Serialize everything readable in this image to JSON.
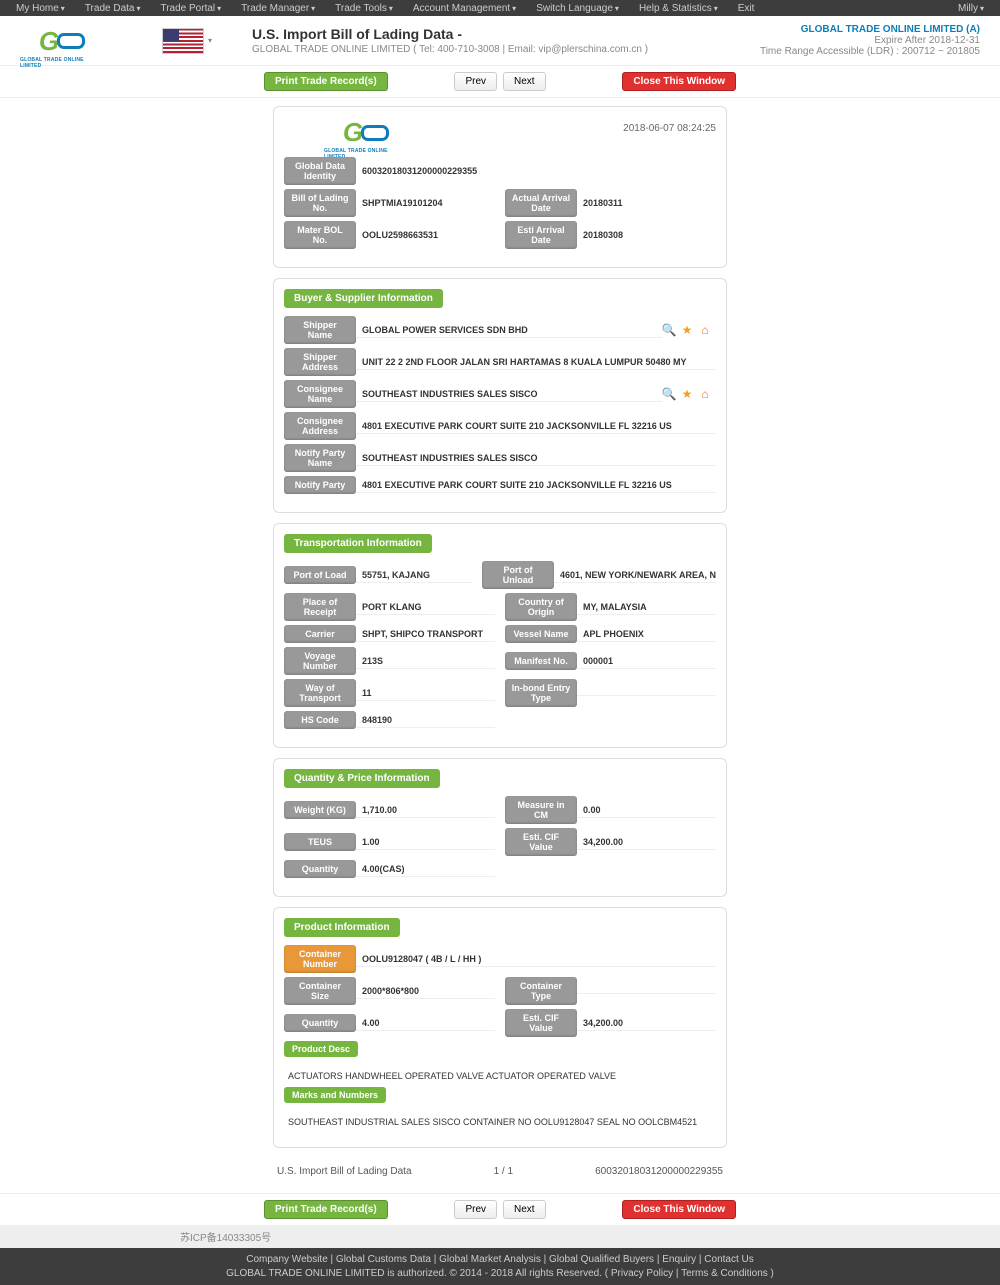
{
  "nav": {
    "items": [
      "My Home",
      "Trade Data",
      "Trade Portal",
      "Trade Manager",
      "Trade Tools",
      "Account Management",
      "Switch Language",
      "Help & Statistics",
      "Exit"
    ],
    "user": "Milly"
  },
  "header": {
    "title": "U.S. Import Bill of Lading Data  -",
    "sub": "GLOBAL TRADE ONLINE LIMITED ( Tel: 400-710-3008 | Email: vip@plerschina.com.cn )",
    "company": "GLOBAL TRADE ONLINE LIMITED (A)",
    "expire": "Expire After 2018-12-31",
    "range": "Time Range Accessible (LDR) : 200712 ~ 201805"
  },
  "buttons": {
    "print": "Print Trade Record(s)",
    "prev": "Prev",
    "next": "Next",
    "close": "Close This Window"
  },
  "record": {
    "timestamp": "2018-06-07 08:24:25",
    "identity_label": "Global Data Identity",
    "identity": "60032018031200000229355",
    "bol_label": "Bill of Lading No.",
    "bol": "SHPTMIA19101204",
    "mbol_label": "Mater BOL No.",
    "mbol": "OOLU2598663531",
    "aad_label": "Actual Arrival Date",
    "aad": "20180311",
    "ead_label": "Esti Arrival Date",
    "ead": "20180308"
  },
  "buyer": {
    "title": "Buyer & Supplier Information",
    "shipper_name_l": "Shipper Name",
    "shipper_name": "GLOBAL POWER SERVICES SDN BHD",
    "shipper_addr_l": "Shipper Address",
    "shipper_addr": "UNIT 22 2 2ND FLOOR JALAN SRI HARTAMAS 8 KUALA LUMPUR 50480 MY",
    "consignee_name_l": "Consignee Name",
    "consignee_name": "SOUTHEAST INDUSTRIES SALES SISCO",
    "consignee_addr_l": "Consignee Address",
    "consignee_addr": "4801 EXECUTIVE PARK COURT SUITE 210 JACKSONVILLE FL 32216 US",
    "notify_name_l": "Notify Party Name",
    "notify_name": "SOUTHEAST INDUSTRIES SALES SISCO",
    "notify_addr_l": "Notify Party",
    "notify_addr": "4801 EXECUTIVE PARK COURT SUITE 210 JACKSONVILLE FL 32216 US"
  },
  "transport": {
    "title": "Transportation Information",
    "pol_l": "Port of Load",
    "pol": "55751, KAJANG",
    "pou_l": "Port of Unload",
    "pou": "4601, NEW YORK/NEWARK AREA, N",
    "por_l": "Place of Receipt",
    "por": "PORT KLANG",
    "coo_l": "Country of Origin",
    "coo": "MY, MALAYSIA",
    "carrier_l": "Carrier",
    "carrier": "SHPT, SHIPCO TRANSPORT",
    "vessel_l": "Vessel Name",
    "vessel": "APL PHOENIX",
    "voyage_l": "Voyage Number",
    "voyage": "213S",
    "manifest_l": "Manifest No.",
    "manifest": "000001",
    "way_l": "Way of Transport",
    "way": "11",
    "inbond_l": "In-bond Entry Type",
    "inbond": "",
    "hs_l": "HS Code",
    "hs": "848190"
  },
  "qty": {
    "title": "Quantity & Price Information",
    "weight_l": "Weight (KG)",
    "weight": "1,710.00",
    "measure_l": "Measure in CM",
    "measure": "0.00",
    "teus_l": "TEUS",
    "teus": "1.00",
    "cif_l": "Esti. CIF Value",
    "cif": "34,200.00",
    "quantity_l": "Quantity",
    "quantity": "4.00(CAS)"
  },
  "product": {
    "title": "Product Information",
    "container_l": "Container Number",
    "container": "OOLU9128047 ( 4B / L / HH )",
    "size_l": "Container Size",
    "size": "2000*806*800",
    "type_l": "Container Type",
    "type": "",
    "qty_l": "Quantity",
    "qty": "4.00",
    "cif_l": "Esti. CIF Value",
    "cif": "34,200.00",
    "desc_l": "Product Desc",
    "desc": "ACTUATORS HANDWHEEL OPERATED VALVE ACTUATOR OPERATED VALVE",
    "marks_l": "Marks and Numbers",
    "marks": "SOUTHEAST INDUSTRIAL SALES SISCO CONTAINER NO OOLU9128047 SEAL NO OOLCBM4521"
  },
  "page_foot": {
    "left": "U.S. Import Bill of Lading Data",
    "mid": "1 / 1",
    "right": "60032018031200000229355"
  },
  "footer": {
    "links": [
      "Company Website",
      "Global Customs Data",
      "Global Market Analysis",
      "Global Qualified Buyers",
      "Enquiry",
      "Contact Us"
    ],
    "line2": "GLOBAL TRADE ONLINE LIMITED is authorized. © 2014 - 2018 All rights Reserved.   (  Privacy Policy | Terms & Conditions  )",
    "icp": "苏ICP备14033305号"
  }
}
